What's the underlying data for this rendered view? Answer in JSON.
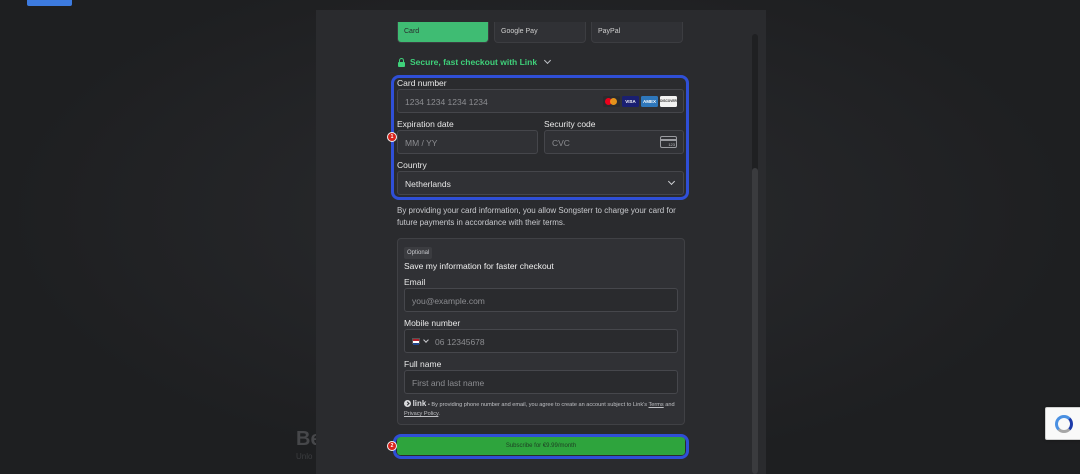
{
  "payment_tabs": [
    "Card",
    "Google Pay",
    "PayPal"
  ],
  "link_checkout": {
    "label": "Secure, fast checkout with Link"
  },
  "card": {
    "number_label": "Card number",
    "number_placeholder": "1234 1234 1234 1234",
    "brands": [
      "mastercard-icon",
      "visa-icon",
      "amex-icon",
      "discover-icon"
    ],
    "brand_text": {
      "visa": "VISA",
      "amex": "AMEX",
      "discover": "DISCOVER"
    },
    "expiry_label": "Expiration date",
    "expiry_placeholder": "MM / YY",
    "cvc_label": "Security code",
    "cvc_placeholder": "CVC",
    "cvc_icon_number": "123",
    "country_label": "Country",
    "country_value": "Netherlands"
  },
  "notice": "By providing your card information, you allow Songsterr to charge your card for future payments in accordance with their terms.",
  "save_info": {
    "badge": "Optional",
    "title": "Save my information for faster checkout",
    "email_label": "Email",
    "email_placeholder": "you@example.com",
    "mobile_label": "Mobile number",
    "mobile_placeholder": "06 12345678",
    "fullname_label": "Full name",
    "fullname_placeholder": "First and last name",
    "legal": {
      "brand": "link",
      "text_before": " • By providing phone number and email, you agree to create an account subject to Link's ",
      "terms": "Terms",
      "and": " and ",
      "privacy": "Privacy Policy",
      "end": "."
    }
  },
  "subscribe_label": "Subscribe for €9.99/month",
  "markers": [
    "1",
    "2"
  ],
  "background": {
    "title": "Be",
    "subtitle": "Unlo"
  },
  "colors": {
    "accent_green": "#3fd07a",
    "button_green": "#2ea43d",
    "highlight_blue": "#2f4fd6",
    "marker_red": "#d9241c"
  }
}
